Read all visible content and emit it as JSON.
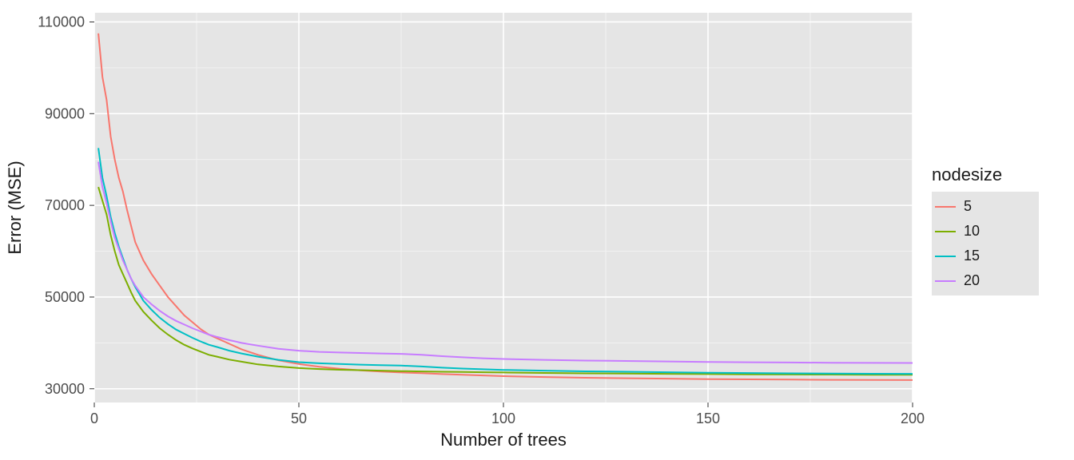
{
  "chart_data": {
    "type": "line",
    "title": "",
    "xlabel": "Number of trees",
    "ylabel": "Error (MSE)",
    "xlim": [
      0,
      200
    ],
    "ylim": [
      27000,
      112000
    ],
    "x_ticks": [
      0,
      50,
      100,
      150,
      200
    ],
    "y_ticks": [
      30000,
      50000,
      70000,
      90000,
      110000
    ],
    "legend_title": "nodesize",
    "legend_position": "right",
    "grid": true,
    "x": [
      1,
      2,
      3,
      4,
      5,
      6,
      7,
      8,
      9,
      10,
      12,
      14,
      16,
      18,
      20,
      22,
      24,
      26,
      28,
      30,
      33,
      36,
      40,
      45,
      50,
      55,
      60,
      65,
      70,
      75,
      80,
      85,
      90,
      95,
      100,
      110,
      120,
      130,
      140,
      150,
      160,
      170,
      180,
      190,
      200
    ],
    "series": [
      {
        "name": "5",
        "color": "#F8766D",
        "values": [
          107500,
          98000,
          93000,
          85000,
          80000,
          76000,
          73000,
          69000,
          65500,
          62000,
          58000,
          55000,
          52500,
          50000,
          48000,
          46000,
          44500,
          43000,
          41800,
          41000,
          39800,
          38600,
          37400,
          36200,
          35400,
          34800,
          34350,
          34000,
          33750,
          33550,
          33400,
          33200,
          33050,
          32900,
          32750,
          32550,
          32400,
          32300,
          32200,
          32100,
          32050,
          32000,
          31950,
          31920,
          31900
        ]
      },
      {
        "name": "10",
        "color": "#7CAE00",
        "values": [
          74000,
          71000,
          68000,
          63500,
          60000,
          57000,
          55000,
          53000,
          51000,
          49200,
          46800,
          44900,
          43200,
          41800,
          40600,
          39600,
          38800,
          38100,
          37400,
          37000,
          36350,
          35900,
          35300,
          34850,
          34500,
          34300,
          34150,
          34050,
          33950,
          33850,
          33770,
          33700,
          33650,
          33600,
          33550,
          33450,
          33350,
          33300,
          33250,
          33200,
          33150,
          33120,
          33100,
          33070,
          33050
        ]
      },
      {
        "name": "15",
        "color": "#00BFC4",
        "values": [
          82500,
          76000,
          72000,
          67500,
          64000,
          61000,
          58500,
          56000,
          54000,
          52200,
          49200,
          47200,
          45500,
          44100,
          42900,
          42000,
          41100,
          40300,
          39600,
          39100,
          38300,
          37700,
          37000,
          36300,
          35800,
          35550,
          35400,
          35250,
          35150,
          35050,
          34850,
          34600,
          34400,
          34250,
          34100,
          33950,
          33800,
          33700,
          33600,
          33500,
          33420,
          33350,
          33300,
          33270,
          33250
        ]
      },
      {
        "name": "20",
        "color": "#C77CFF",
        "values": [
          79500,
          74000,
          70500,
          66500,
          63000,
          60500,
          58000,
          56000,
          54000,
          52500,
          50000,
          48400,
          47000,
          45800,
          44800,
          44000,
          43200,
          42500,
          41800,
          41300,
          40600,
          40000,
          39400,
          38700,
          38300,
          38050,
          37900,
          37800,
          37700,
          37600,
          37400,
          37100,
          36850,
          36650,
          36500,
          36300,
          36150,
          36050,
          35950,
          35850,
          35780,
          35720,
          35670,
          35640,
          35620
        ]
      }
    ]
  }
}
